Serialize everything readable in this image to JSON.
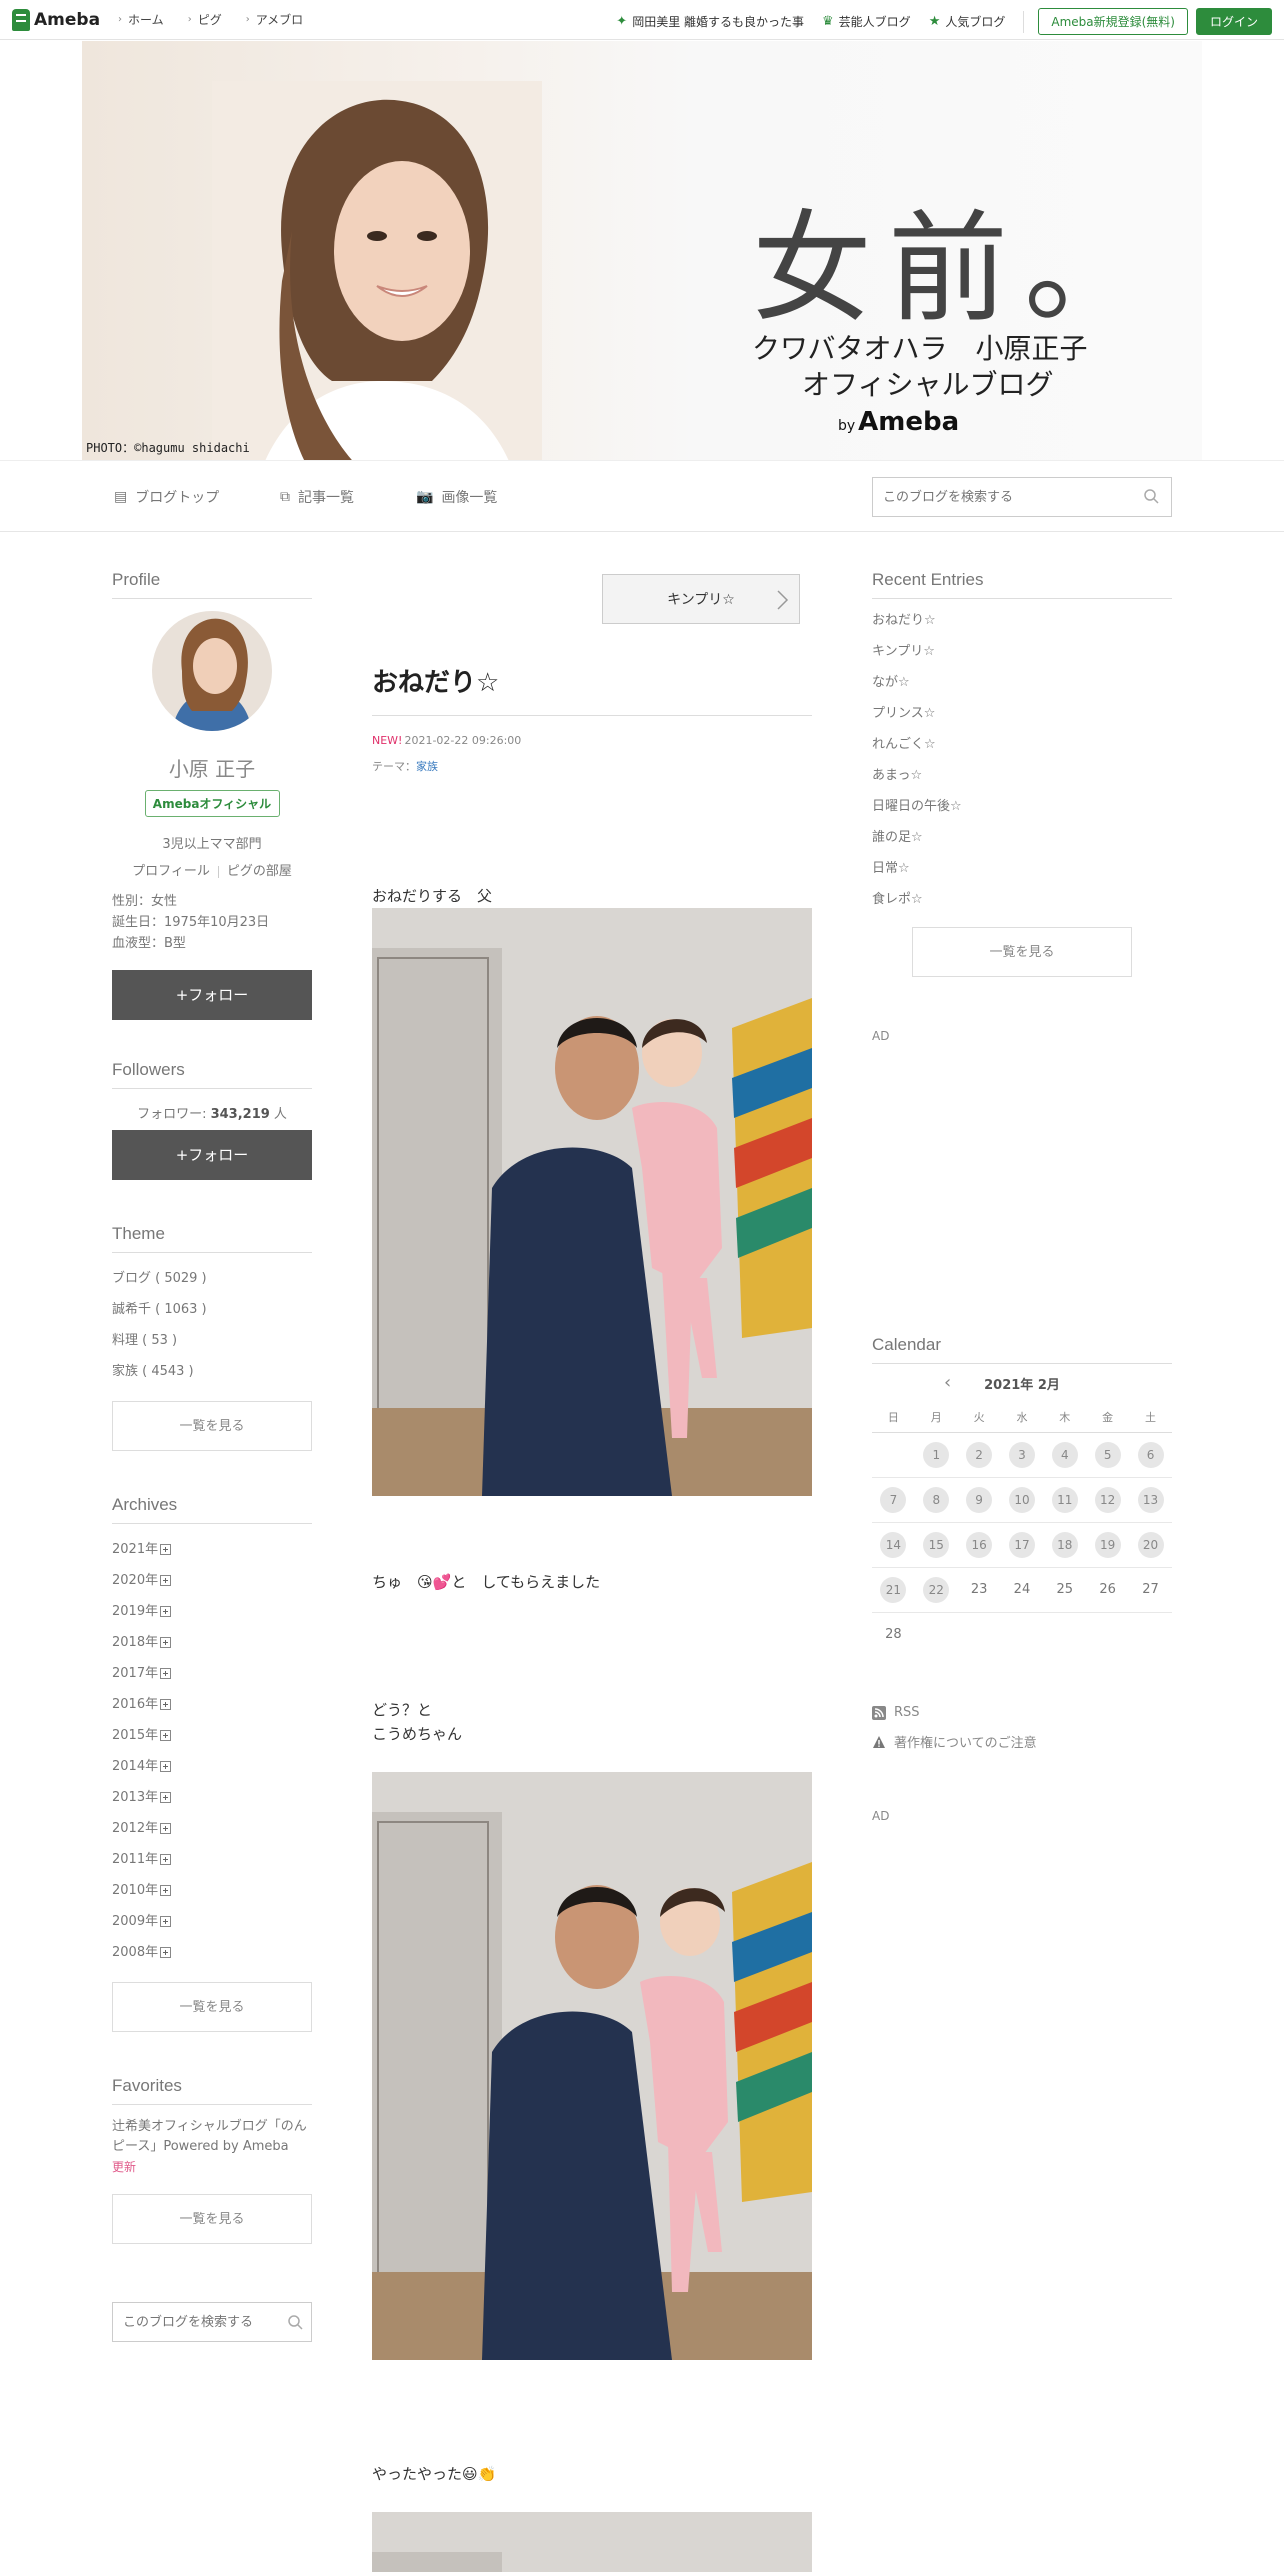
{
  "topbar": {
    "logo": "Ameba",
    "nav": [
      "ホーム",
      "ピグ",
      "アメブロ"
    ],
    "links": [
      "岡田美里 離婚するも良かった事",
      "芸能人ブログ",
      "人気ブログ"
    ],
    "register": "Ameba新規登録(無料)",
    "login": "ログイン"
  },
  "banner": {
    "title": "女前。",
    "subtitle1": "クワバタオハラ　小原正子",
    "subtitle2": "オフィシャルブログ",
    "by": "by",
    "brand": "Ameba",
    "credit": "PHOTO：©hagumu shidachi"
  },
  "blognav": {
    "top": "ブログトップ",
    "entries": "記事一覧",
    "images": "画像一覧",
    "search_placeholder": "このブログを検索する"
  },
  "profile": {
    "heading": "Profile",
    "name": "小原 正子",
    "badge": "Amebaオフィシャル",
    "desc": "3児以上ママ部門",
    "link_profile": "プロフィール",
    "link_pig": "ピグの部屋",
    "gender": "性別：女性",
    "birthday": "誕生日：1975年10月23日",
    "blood": "血液型：B型",
    "follow": "+フォロー"
  },
  "followers": {
    "heading": "Followers",
    "label": "フォロワー: ",
    "count": "343,219",
    "unit": " 人",
    "follow": "+フォロー"
  },
  "theme": {
    "heading": "Theme",
    "items": [
      "ブログ ( 5029 )",
      "誠希千 ( 1063 )",
      "料理 ( 53 )",
      "家族 ( 4543 )"
    ],
    "more": "一覧を見る"
  },
  "archives": {
    "heading": "Archives",
    "items": [
      "2021年",
      "2020年",
      "2019年",
      "2018年",
      "2017年",
      "2016年",
      "2015年",
      "2014年",
      "2013年",
      "2012年",
      "2011年",
      "2010年",
      "2009年",
      "2008年"
    ],
    "more": "一覧を見る"
  },
  "favorites": {
    "heading": "Favorites",
    "text": "辻希美オフィシャルブログ「のんピース」Powered by Ameba",
    "new": "更新",
    "more": "一覧を見る"
  },
  "sidesearch": {
    "placeholder": "このブログを検索する"
  },
  "entry": {
    "next": "キンプリ☆",
    "title": "おねだり☆",
    "new": "NEW!",
    "date": "2021-02-22 09:26:00",
    "theme_label": "テーマ：",
    "theme": "家族",
    "text1": "おねだりする　父",
    "text2": "ちゅ　😘💕と　してもらえました",
    "text3a": "どう？と",
    "text3b": "こうめちゃん",
    "text4": "やったやった😃👏"
  },
  "recent": {
    "heading": "Recent Entries",
    "items": [
      "おねだり☆",
      "キンプリ☆",
      "なが☆",
      "プリンス☆",
      "れんごく☆",
      "あまっ☆",
      "日曜日の午後☆",
      "誰の足☆",
      "日常☆",
      "食レポ☆"
    ],
    "more": "一覧を見る"
  },
  "ad": "AD",
  "calendar": {
    "heading": "Calendar",
    "month": "2021年 2月",
    "days": [
      "日",
      "月",
      "火",
      "水",
      "木",
      "金",
      "土"
    ],
    "weeks": [
      [
        "",
        "1",
        "2",
        "3",
        "4",
        "5",
        "6"
      ],
      [
        "7",
        "8",
        "9",
        "10",
        "11",
        "12",
        "13"
      ],
      [
        "14",
        "15",
        "16",
        "17",
        "18",
        "19",
        "20"
      ],
      [
        "21",
        "22",
        "23",
        "24",
        "25",
        "26",
        "27"
      ],
      [
        "28",
        "",
        "",
        "",
        "",
        "",
        ""
      ]
    ]
  },
  "rss": "RSS",
  "copyright": "著作権についてのご注意",
  "colors": {
    "accent": "#2d8c3c",
    "new": "#e0306a"
  }
}
